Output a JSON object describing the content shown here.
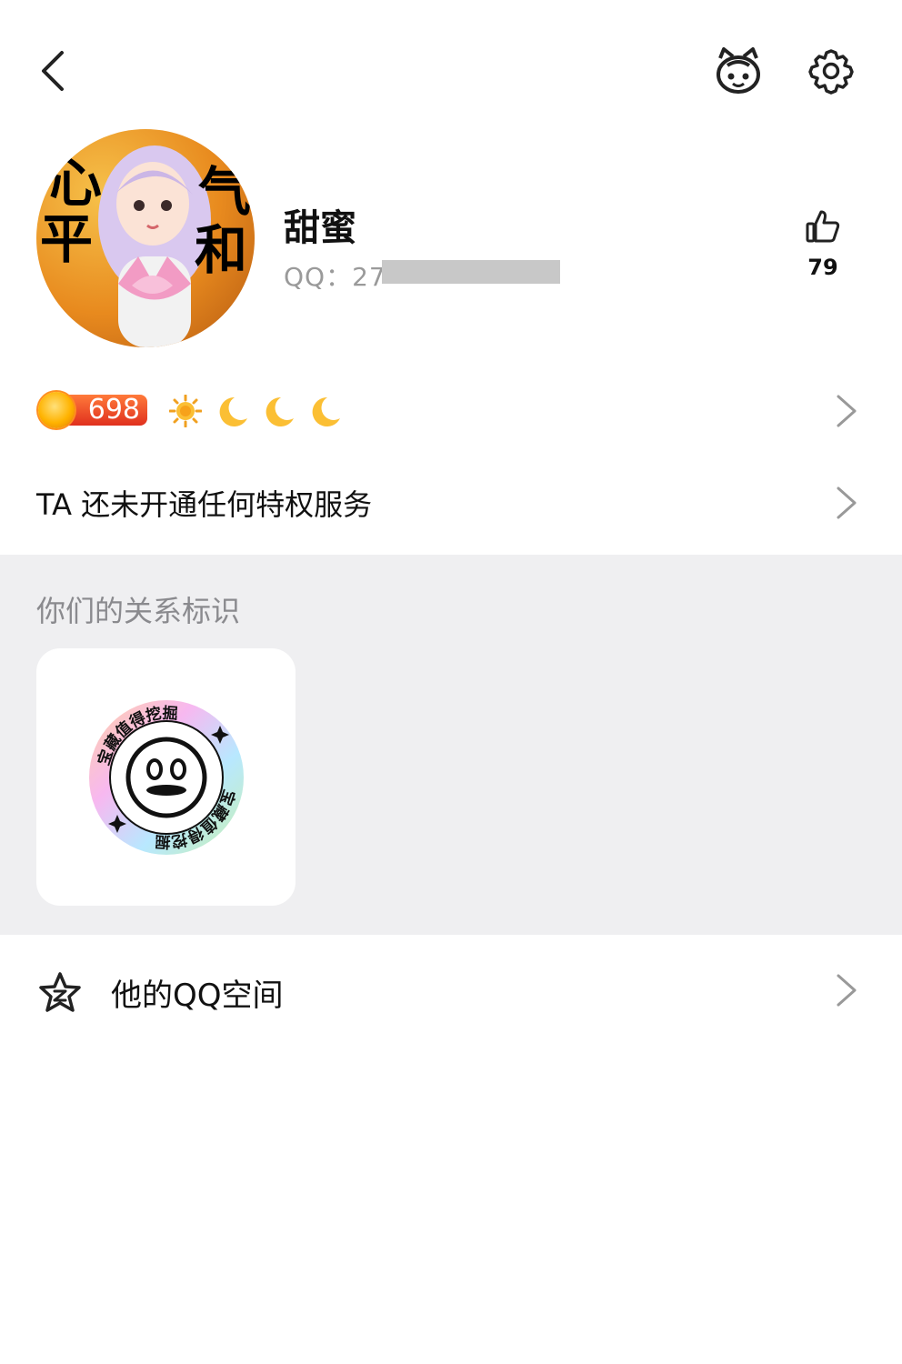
{
  "header": {
    "back_icon": "back-arrow-icon",
    "mascot_icon": "mascot-icon",
    "settings_icon": "gear-icon"
  },
  "profile": {
    "avatar_text": [
      "心",
      "平",
      "气",
      "和"
    ],
    "name": "甜蜜",
    "qq_label": "QQ：27",
    "like_count": "79"
  },
  "level": {
    "value": "698",
    "badges": [
      "sun-icon",
      "moon-icon",
      "moon-icon",
      "moon-icon"
    ]
  },
  "privilege": {
    "text": "TA 还未开通任何特权服务"
  },
  "relationship": {
    "title": "你们的关系标识",
    "badge_text_top": "宝藏值得挖掘",
    "badge_text_bottom": "宝藏值得挖掘"
  },
  "qzone": {
    "label": "他的QQ空间"
  },
  "colors": {
    "accent_orange": "#ff7a3a",
    "section_gray": "#efeff1",
    "secondary_text": "#8a8a8e"
  }
}
